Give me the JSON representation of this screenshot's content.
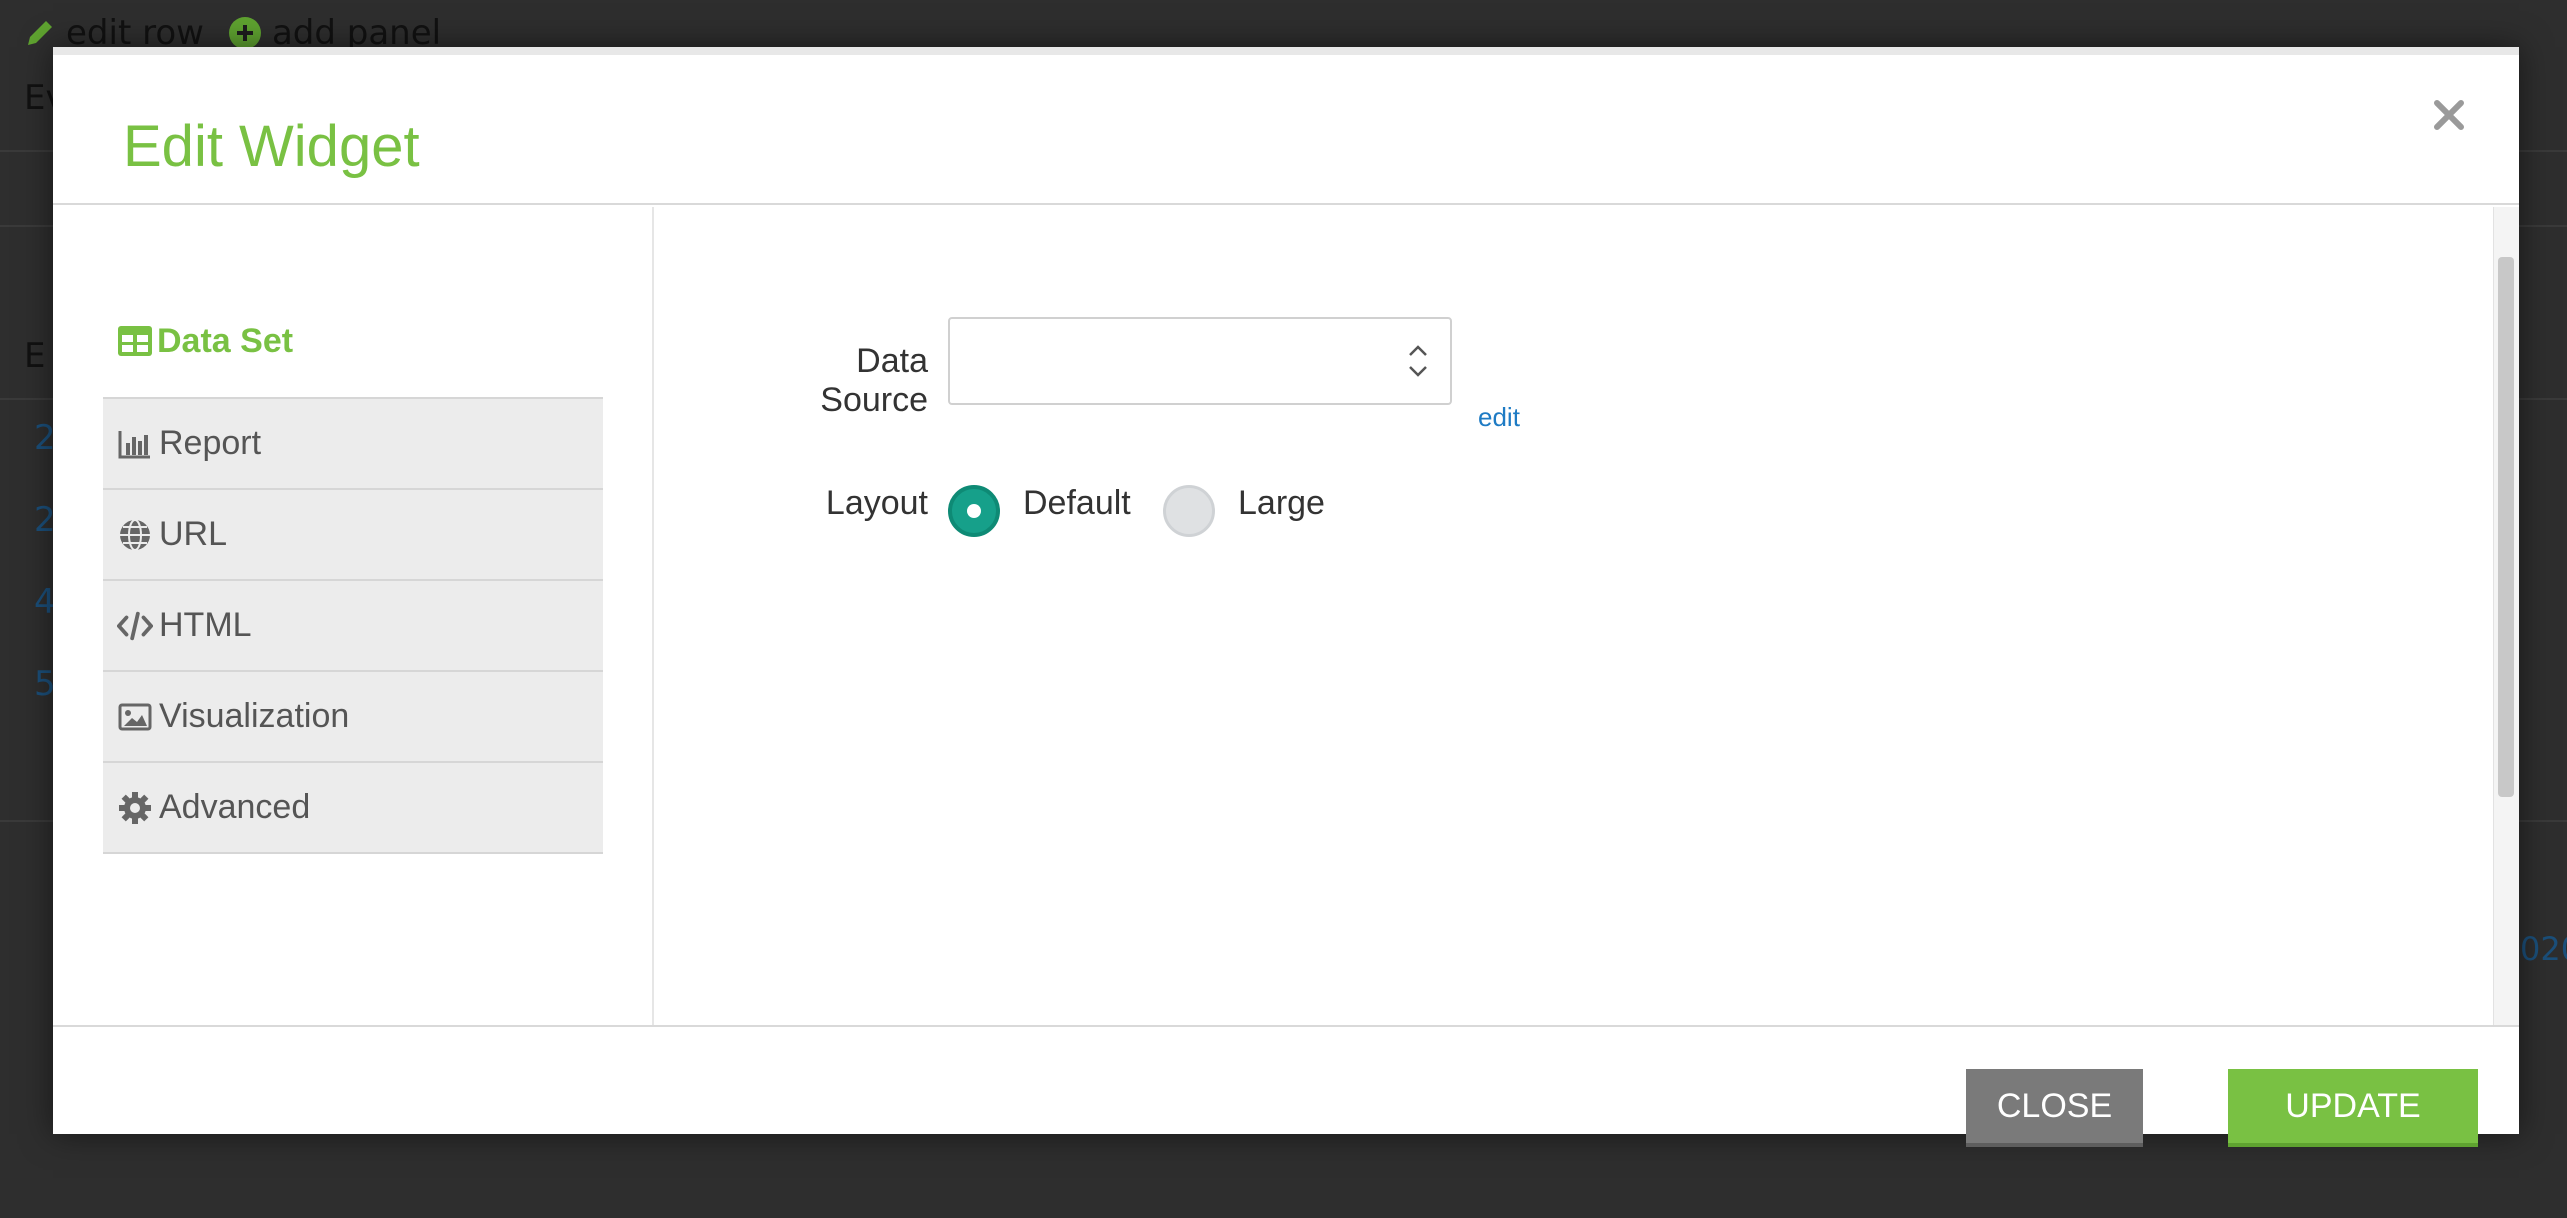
{
  "background": {
    "toolbar": {
      "edit_row": "edit row",
      "add_panel": "add panel"
    },
    "left_text_1": "Ev",
    "left_text_2": "E",
    "rows": [
      "2",
      "2",
      "4",
      "5"
    ],
    "right_text": "020"
  },
  "modal": {
    "title": "Edit Widget",
    "close_icon": "close-x-icon",
    "tabs": {
      "active": {
        "label": "Data Set",
        "icon": "table-icon"
      },
      "items": [
        {
          "label": "Report",
          "icon": "bar-chart-icon"
        },
        {
          "label": "URL",
          "icon": "globe-icon"
        },
        {
          "label": "HTML",
          "icon": "code-icon"
        },
        {
          "label": "Visualization",
          "icon": "image-icon"
        },
        {
          "label": "Advanced",
          "icon": "gear-icon"
        }
      ]
    },
    "form": {
      "data_source_label": "Data Source",
      "data_source_value": "",
      "edit_link": "edit",
      "layout_label": "Layout",
      "layout_options": [
        {
          "label": "Default",
          "selected": true
        },
        {
          "label": "Large",
          "selected": false
        }
      ]
    },
    "footer": {
      "close_label": "CLOSE",
      "update_label": "UPDATE"
    }
  },
  "colors": {
    "accent_green": "#79c143",
    "radio_teal": "#16a08a",
    "close_gray": "#7a7a7a",
    "link_blue": "#1e7bc4"
  }
}
